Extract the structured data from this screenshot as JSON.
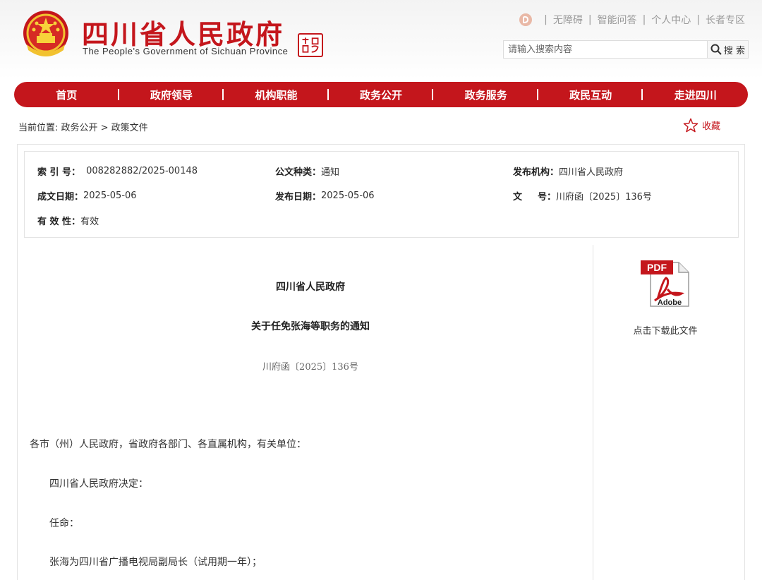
{
  "header": {
    "title": "四川省人民政府",
    "subtitle": "The People's Government of Sichuan Province",
    "top_links": [
      "无障碍",
      "智能问答",
      "个人中心",
      "长者专区"
    ],
    "search": {
      "placeholder": "请输入搜索内容",
      "button_label": "搜 索"
    },
    "accent_color": "#c4161c"
  },
  "nav": {
    "items": [
      "首页",
      "政府领导",
      "机构职能",
      "政务公开",
      "政务服务",
      "政民互动",
      "走进四川"
    ]
  },
  "breadcrumb": "当前位置:  政务公开 > 政策文件",
  "favorite_label": "收藏",
  "meta": {
    "index_label": "索 引 号：",
    "index_value": "008282882/2025-00148",
    "doc_type_label": "公文种类：",
    "doc_type_value": "通知",
    "publisher_label": "发布机构：",
    "publisher_value": "四川省人民政府",
    "created_label": "成文日期：",
    "created_value": "2025-05-06",
    "published_label": "发布日期：",
    "published_value": "2025-05-06",
    "number_label_a": "文",
    "number_label_b": "号：",
    "number_value": "川府函〔2025〕136号",
    "validity_label": "有 效 性：",
    "validity_value": "有效"
  },
  "document": {
    "org": "四川省人民政府",
    "title": "关于任免张海等职务的通知",
    "number": "川府函〔2025〕136号",
    "paragraphs": [
      "各市（州）人民政府，省政府各部门、各直属机构，有关单位：",
      "四川省人民政府决定：",
      "任命：",
      "张海为四川省广播电视局副局长（试用期一年）；"
    ]
  },
  "attachment": {
    "pdf_label": "PDF",
    "brand_label": "Adobe",
    "download_label": "点击下载此文件"
  }
}
